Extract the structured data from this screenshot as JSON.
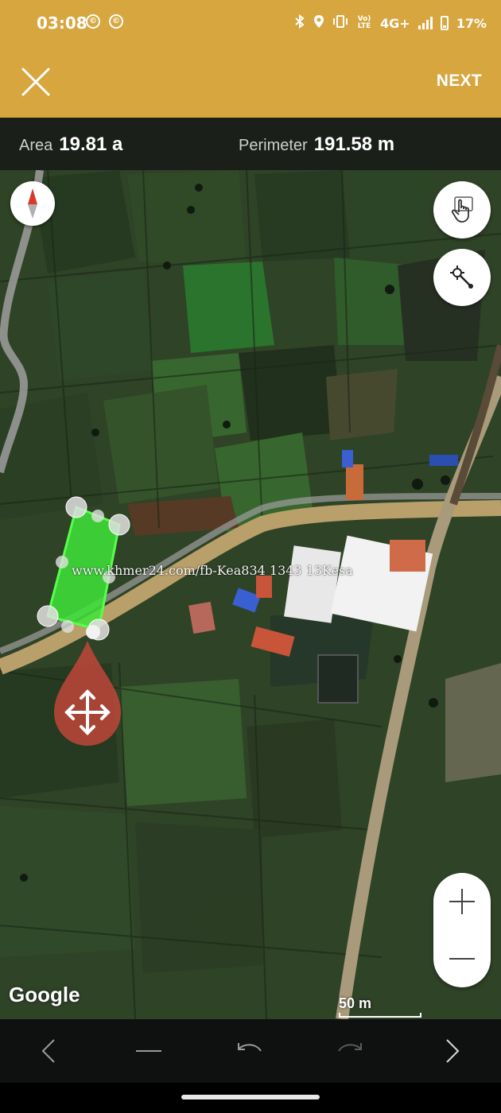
{
  "status_bar": {
    "time": "03:08",
    "notification_icons": [
      "notification-badge-icon",
      "notification-badge-icon"
    ],
    "notification_glyph": "©",
    "network": "4G+",
    "volte": "Vo) LTE",
    "battery": "17%",
    "icons": [
      "bluetooth-icon",
      "location-icon",
      "vibrate-icon",
      "volte-icon",
      "signal-icon",
      "battery-icon"
    ]
  },
  "toolbar": {
    "close_icon": "close-icon",
    "next_label": "NEXT",
    "background_color": "#d7a63f"
  },
  "measurement": {
    "area_label": "Area",
    "area_value": "19.81 a",
    "perimeter_label": "Perimeter",
    "perimeter_value": "191.58 m"
  },
  "map": {
    "attribution": "Google",
    "scale_label": "50 m",
    "watermark": "www.khmer24.com/fb-Kea834  1343      13Kesa",
    "polygon_color": "#3ee53a",
    "controls": [
      "compass-icon",
      "touch-mode-icon",
      "point-mode-icon",
      "zoom-in-icon",
      "zoom-out-icon",
      "move-handle-icon"
    ]
  },
  "bottom_bar": {
    "buttons": [
      "previous-icon",
      "delete-point-icon",
      "undo-icon",
      "redo-icon",
      "next-icon"
    ]
  }
}
